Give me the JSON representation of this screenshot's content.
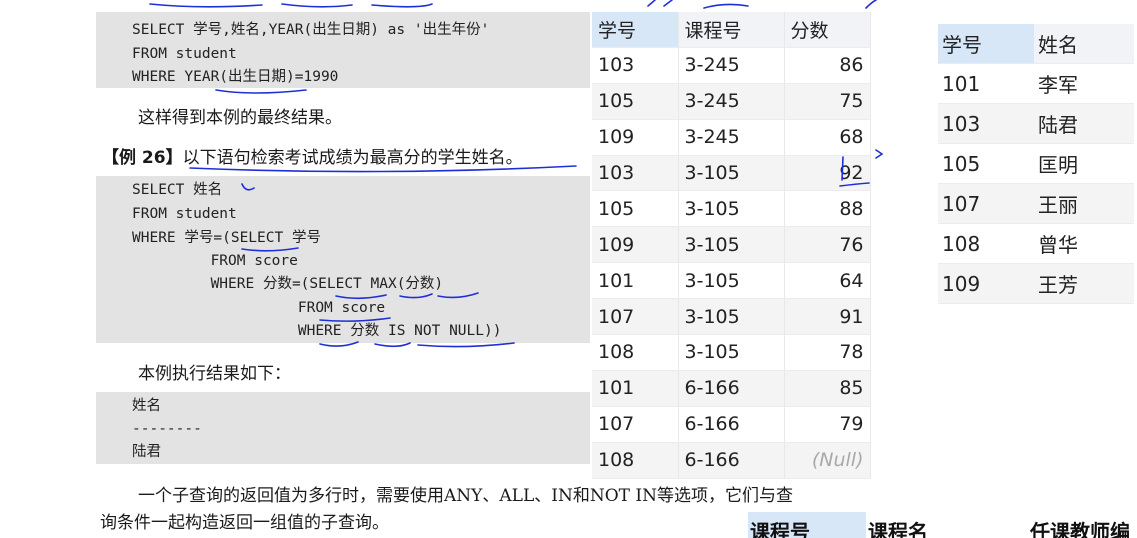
{
  "code_block_1": {
    "lines": [
      "SELECT 学号,姓名,YEAR(出生日期) as '出生年份'",
      "FROM student",
      "WHERE YEAR(出生日期)=1990"
    ]
  },
  "paragraph_1": "这样得到本例的最终结果。",
  "example_26": {
    "label": "【例 26】",
    "text": "以下语句检索考试成绩为最高分的学生姓名。"
  },
  "code_block_2": {
    "lines": [
      "SELECT 姓名",
      "FROM student",
      "WHERE 学号=(SELECT 学号",
      "         FROM score",
      "         WHERE 分数=(SELECT MAX(分数)",
      "                   FROM score",
      "                   WHERE 分数 IS NOT NULL))"
    ]
  },
  "paragraph_2": "本例执行结果如下：",
  "result_block": {
    "lines": [
      "姓名",
      "--------",
      "陆君"
    ]
  },
  "paragraph_3": {
    "line1": "一个子查询的返回值为多行时，需要使用ANY、ALL、IN和NOT IN等选项，它们与查",
    "line2": "询条件一起构造返回一组值的子查询。"
  },
  "score_table": {
    "headers": [
      "学号",
      "课程号",
      "分数"
    ],
    "rows": [
      [
        "103",
        "3-245",
        "86"
      ],
      [
        "105",
        "3-245",
        "75"
      ],
      [
        "109",
        "3-245",
        "68"
      ],
      [
        "103",
        "3-105",
        "92"
      ],
      [
        "105",
        "3-105",
        "88"
      ],
      [
        "109",
        "3-105",
        "76"
      ],
      [
        "101",
        "3-105",
        "64"
      ],
      [
        "107",
        "3-105",
        "91"
      ],
      [
        "108",
        "3-105",
        "78"
      ],
      [
        "101",
        "6-166",
        "85"
      ],
      [
        "107",
        "6-166",
        "79"
      ],
      [
        "108",
        "6-166",
        "(Null)"
      ]
    ]
  },
  "student_table": {
    "headers": [
      "学号",
      "姓名"
    ],
    "rows": [
      [
        "101",
        "李军"
      ],
      [
        "103",
        "陆君"
      ],
      [
        "105",
        "匡明"
      ],
      [
        "107",
        "王丽"
      ],
      [
        "108",
        "曾华"
      ],
      [
        "109",
        "王芳"
      ]
    ]
  },
  "bottom_table_headers": [
    "课程号",
    "课程名",
    "任课教师编"
  ],
  "colors": {
    "code_bg": "#e3e3e3",
    "ink": "#1f2fd6",
    "header_selected": "#d8e7f8"
  }
}
